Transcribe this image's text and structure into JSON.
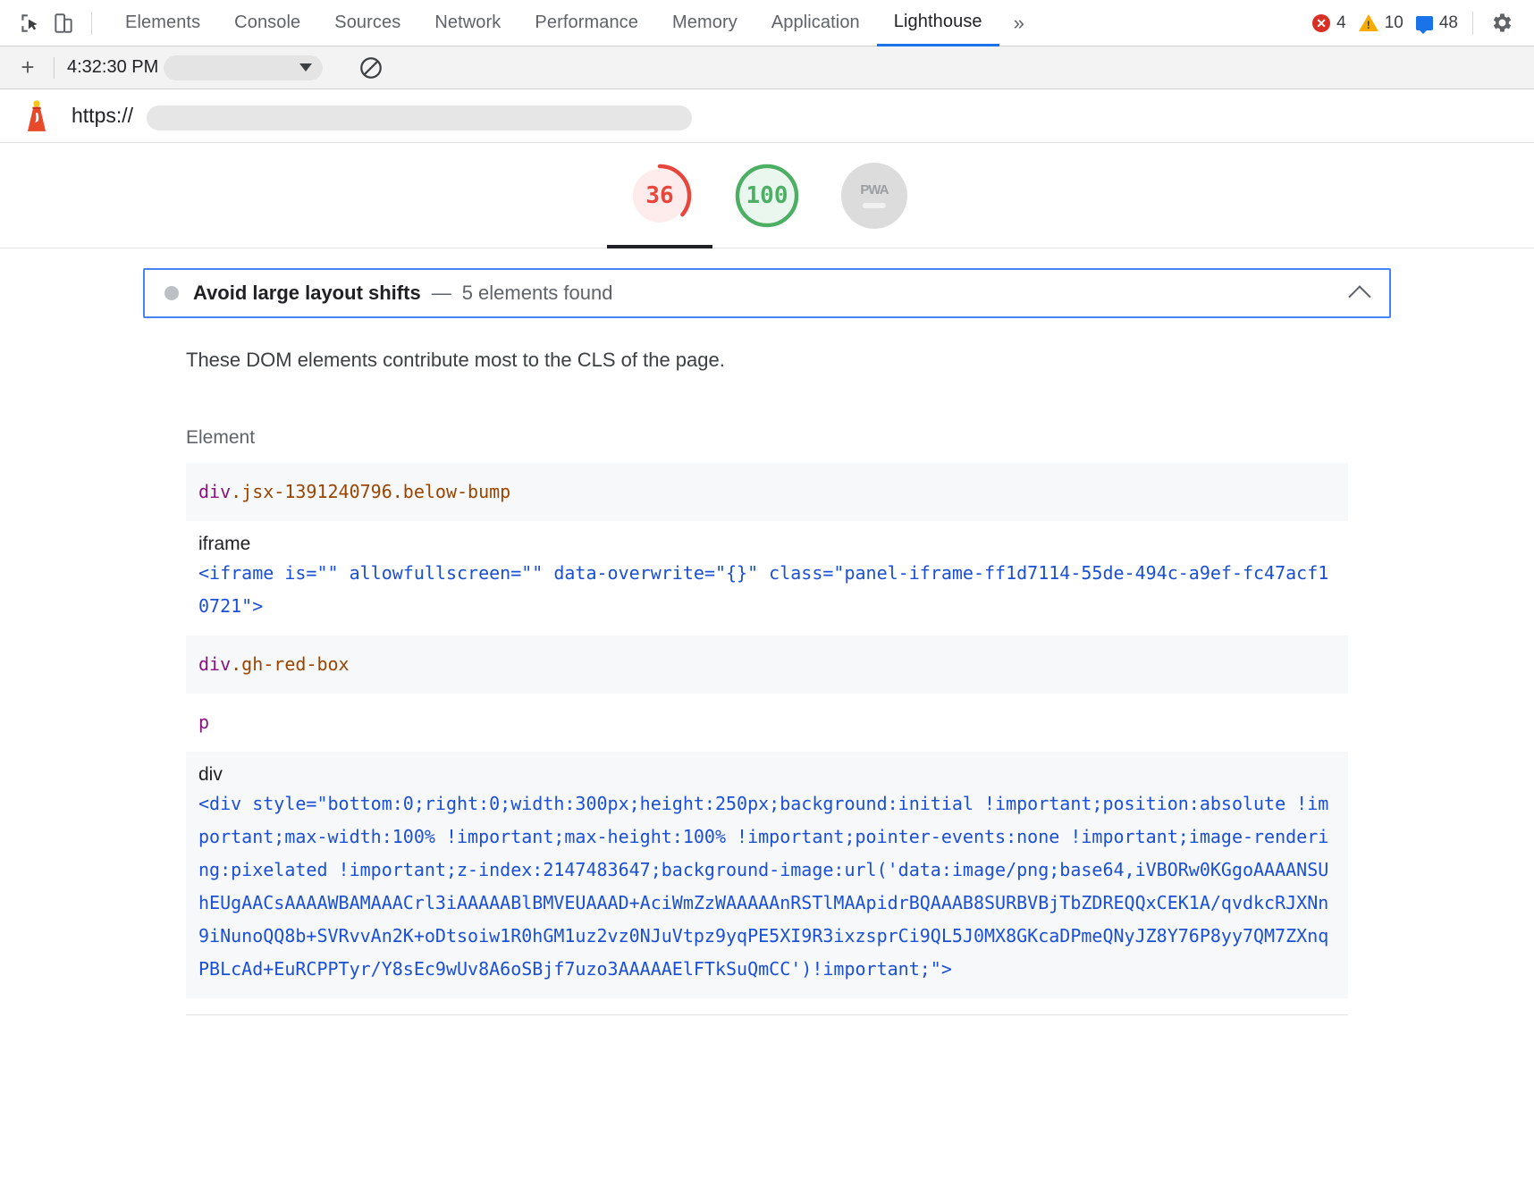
{
  "devtools": {
    "icons": {
      "inspect": "inspect-element-icon",
      "device": "device-toolbar-icon",
      "settings": "gear-icon",
      "more": "»"
    },
    "tabs": [
      {
        "label": "Elements",
        "selected": false
      },
      {
        "label": "Console",
        "selected": false
      },
      {
        "label": "Sources",
        "selected": false
      },
      {
        "label": "Network",
        "selected": false
      },
      {
        "label": "Performance",
        "selected": false
      },
      {
        "label": "Memory",
        "selected": false
      },
      {
        "label": "Application",
        "selected": false
      },
      {
        "label": "Lighthouse",
        "selected": true
      }
    ],
    "counters": {
      "errors": "4",
      "warnings": "10",
      "info": "48"
    }
  },
  "lighthouse_toolbar": {
    "add_label": "+",
    "timestamp": "4:32:30 PM",
    "report_select_value": "",
    "clear_icon": "clear-report-icon"
  },
  "url_bar": {
    "logo": "lighthouse-logo-icon",
    "url": "https://"
  },
  "gauges": [
    {
      "id": "performance",
      "value": "36",
      "color": "#e8453c",
      "track": "#fdeceb",
      "pct": 36,
      "selected": true
    },
    {
      "id": "best-practices",
      "value": "100",
      "color": "#4caf64",
      "track": "#eaf7ee",
      "pct": 100,
      "selected": false
    },
    {
      "id": "pwa",
      "value": "—",
      "label": "PWA",
      "color": "#dcdcdc",
      "pct": 0,
      "selected": false
    }
  ],
  "audit": {
    "title": "Avoid large layout shifts",
    "dash": "—",
    "subtitle": "5 elements found",
    "description": "These DOM elements contribute most to the CLS of the page.",
    "collapse_icon": "chevron-up-icon",
    "column_header": "Element",
    "rows": [
      {
        "kind": "selector",
        "striped": true,
        "tag": "div",
        "classes": ".jsx-1391240796.below-bump"
      },
      {
        "kind": "node",
        "striped": false,
        "label": "iframe",
        "snippet": "<iframe is=\"\" allowfullscreen=\"\" data-overwrite=\"{}\" class=\"panel-iframe-ff1d7114-55de-494c-a9ef-fc47acf10721\">"
      },
      {
        "kind": "selector",
        "striped": true,
        "tag": "div",
        "classes": ".gh-red-box"
      },
      {
        "kind": "selector",
        "striped": false,
        "tag": "p",
        "classes": ""
      },
      {
        "kind": "node",
        "striped": true,
        "label": "div",
        "snippet": "<div style=\"bottom:0;right:0;width:300px;height:250px;background:initial !important;position:absolute !important;max-width:100% !important;max-height:100% !important;pointer-events:none !important;image-rendering:pixelated !important;z-index:2147483647;background-image:url('data:image/png;base64,iVBORw0KGgoAAAANSUhEUgAACsAAAAWBAMAAACrl3iAAAAABlBMVEUAAAD+AciWmZzWAAAAAnRSTlMAApidrBQAAAB8SURBVBjTbZDREQQxCEK1A/qvdkcRJXNn9iNunoQQ8b+SVRvvAn2K+oDtsoiw1R0hGM1uz2vz0NJuVtpz9yqPE5XI9R3ixzsprCi9QL5J0MX8GKcaDPmeQNyJZ8Y76P8yy7QM7ZXnqPBLcAd+EuRCPPTyr/Y8sEc9wUv8A6oSBjf7uzo3AAAAAElFTkSuQmCC')!important;\">"
      }
    ]
  }
}
